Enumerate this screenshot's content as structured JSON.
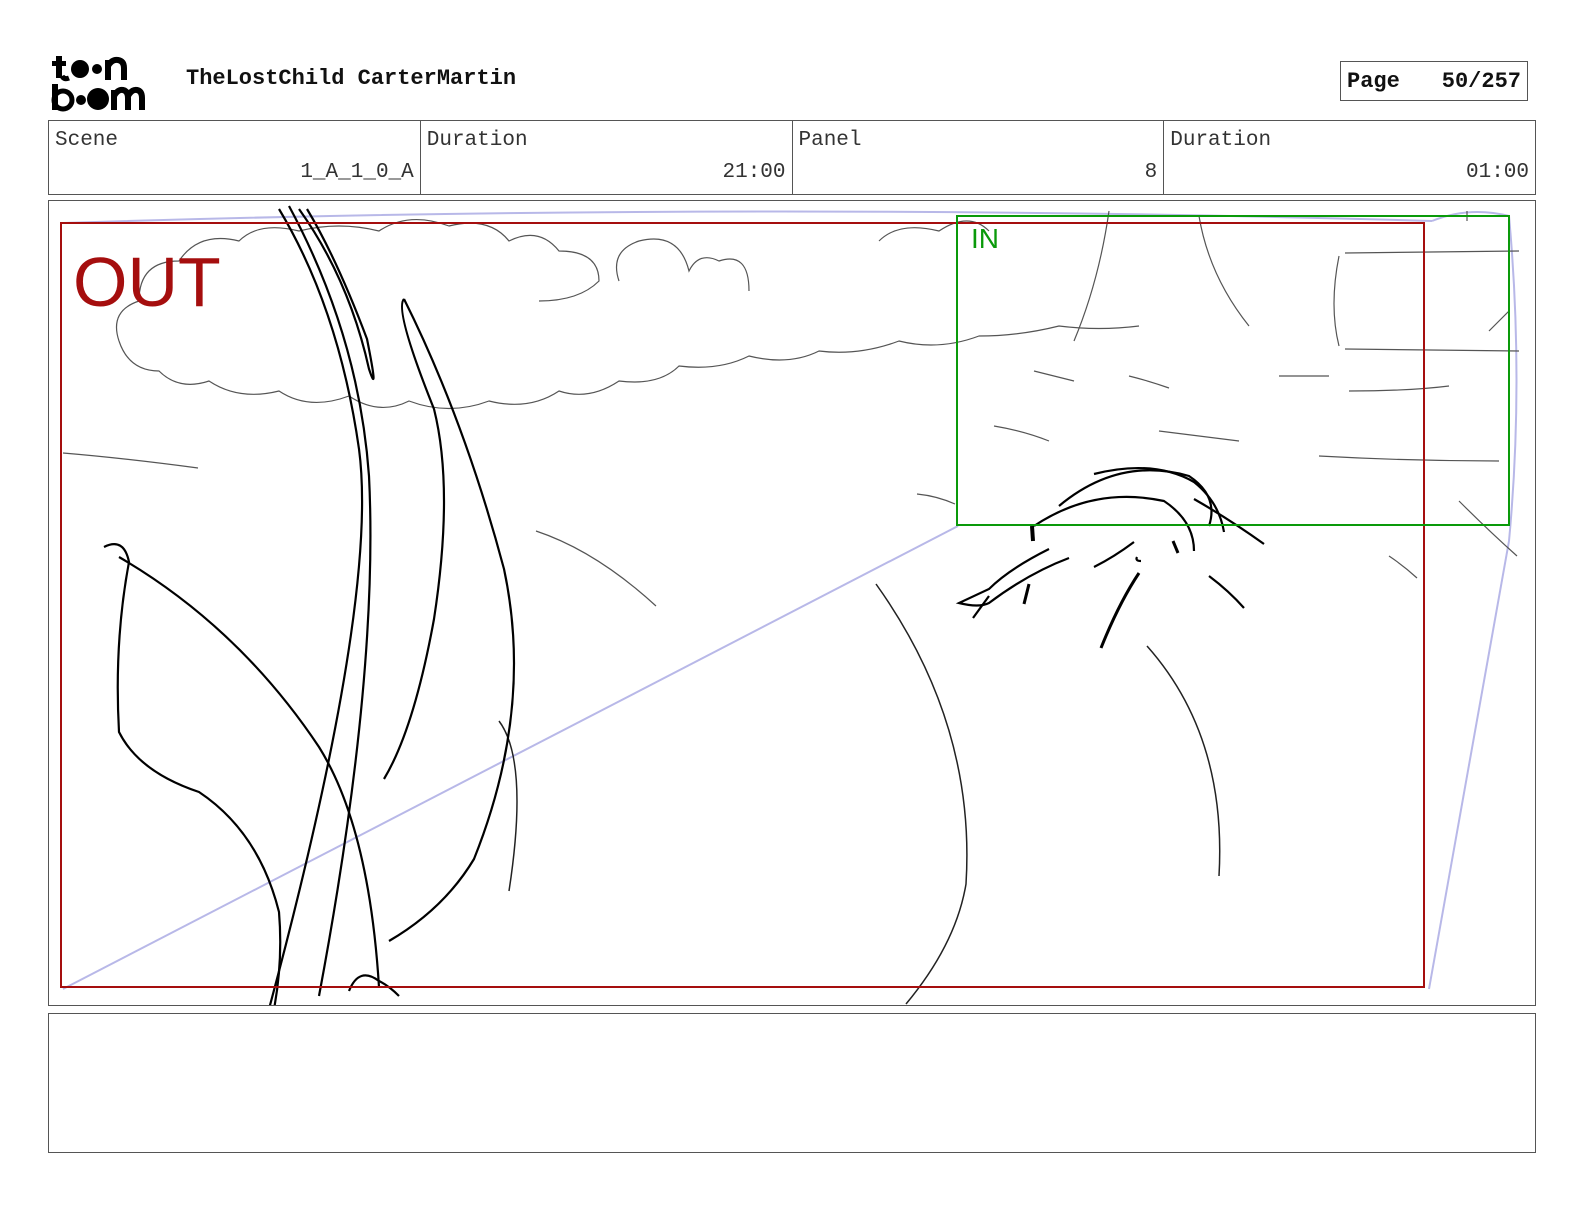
{
  "header": {
    "logo_text": "toon boom",
    "title": "TheLostChild CarterMartin",
    "page_label": "Page",
    "page_value": "50/257"
  },
  "info": {
    "scene_label": "Scene",
    "scene_value": "1_A_1_0_A",
    "duration_label": "Duration",
    "duration_value": "21:00",
    "panel_label": "Panel",
    "panel_value": "8",
    "panel_duration_label": "Duration",
    "panel_duration_value": "01:00"
  },
  "panel": {
    "out_label": "OUT",
    "in_label": "IN",
    "out_color": "#a50e0e",
    "in_color": "#0a9a0a",
    "camera_path_color": "#b8b8e8"
  },
  "notes": {
    "text": ""
  }
}
